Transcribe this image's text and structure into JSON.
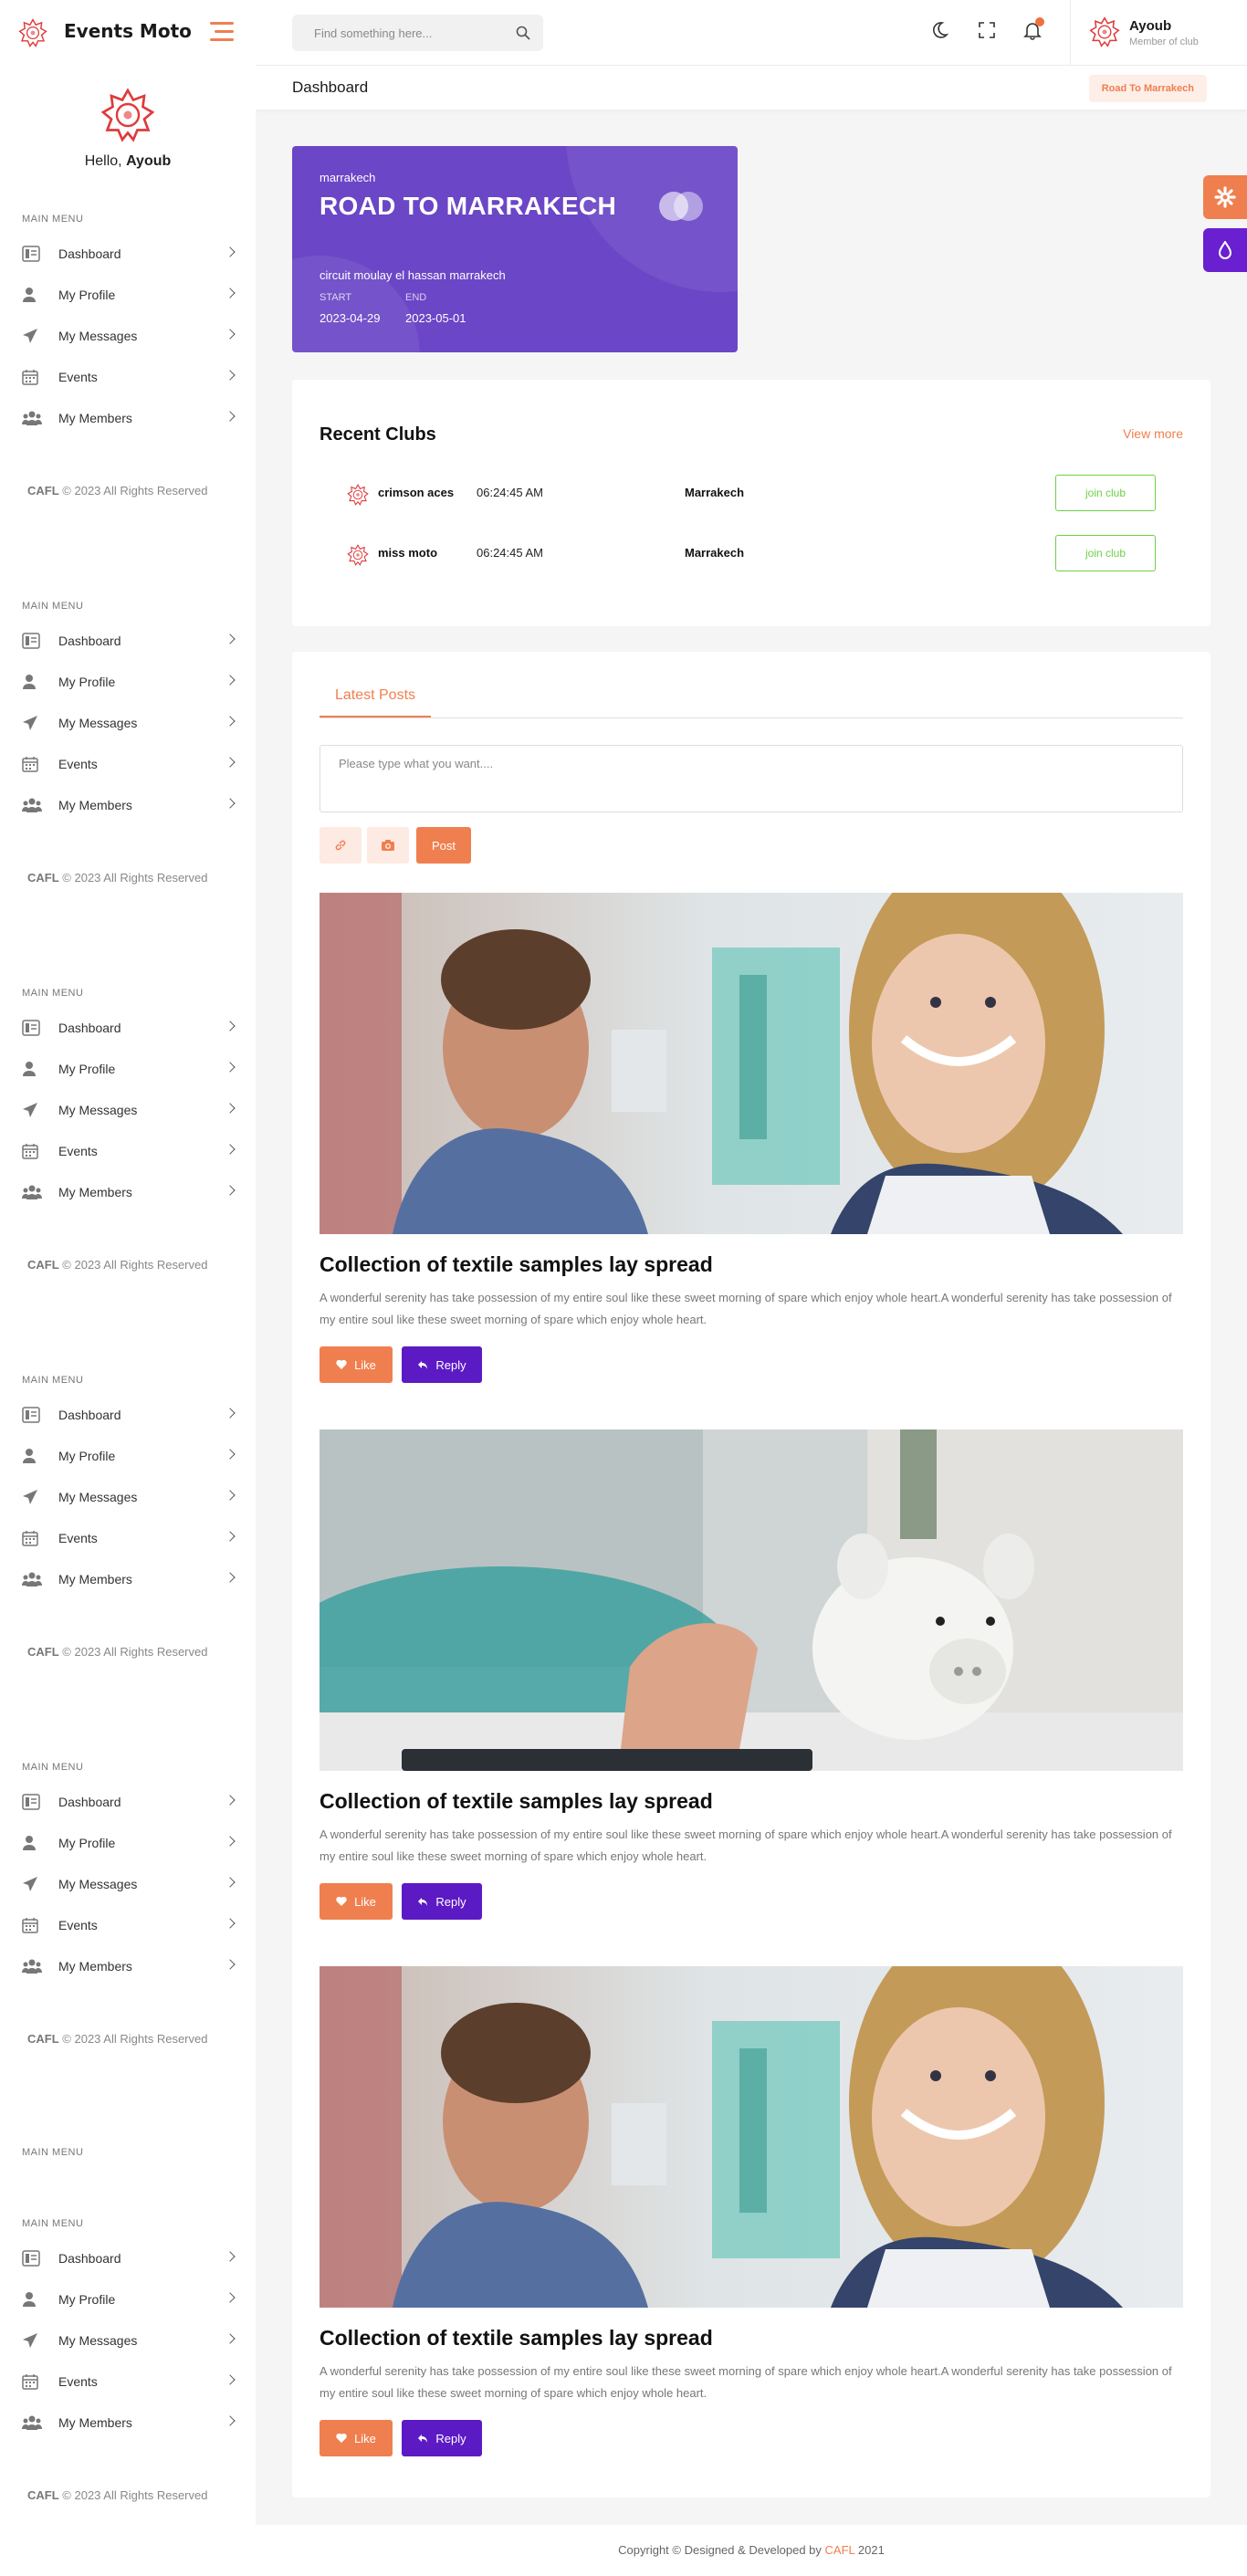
{
  "brand": {
    "name": "Events Moto",
    "logo_icon": "club-emblem-icon"
  },
  "search": {
    "placeholder": "Find something here..."
  },
  "user": {
    "name": "Ayoub",
    "role": "Member of club"
  },
  "page": {
    "title": "Dashboard",
    "breadcrumb": "Road To Marrakech"
  },
  "sidebar": {
    "hello_prefix": "Hello,",
    "hello_name": "Ayoub",
    "menu_title": "MAIN MENU",
    "items": [
      {
        "label": "Dashboard",
        "icon": "dashboard-icon"
      },
      {
        "label": "My Profile",
        "icon": "user-icon"
      },
      {
        "label": "My Messages",
        "icon": "paper-plane-icon"
      },
      {
        "label": "Events",
        "icon": "calendar-icon"
      },
      {
        "label": "My Members",
        "icon": "users-icon"
      }
    ],
    "copyright_brand": "CAFL",
    "copyright_text": "© 2023 All Rights Reserved"
  },
  "event": {
    "location": "marrakech",
    "title": "ROAD TO MARRAKECH",
    "address": "circuit moulay el hassan marrakech",
    "start_label": "START",
    "start": "2023-04-29",
    "end_label": "END",
    "end": "2023-05-01"
  },
  "clubs": {
    "title": "Recent Clubs",
    "view_more": "View more",
    "rows": [
      {
        "name": "crimson aces",
        "time": "06:24:45 AM",
        "city": "Marrakech",
        "action": "join club"
      },
      {
        "name": "miss moto",
        "time": "06:24:45 AM",
        "city": "Marrakech",
        "action": "join club"
      }
    ]
  },
  "posts": {
    "tab": "Latest Posts",
    "placeholder": "Please type what you want....",
    "post_label": "Post",
    "like_label": "Like",
    "reply_label": "Reply",
    "items": [
      {
        "title": "Collection of textile samples lay spread",
        "body": "A wonderful serenity has take possession of my entire soul like these sweet morning of spare which enjoy whole heart.A wonderful serenity has take possession of my entire soul like these sweet morning of spare which enjoy whole heart.",
        "image": "couple-photo"
      },
      {
        "title": "Collection of textile samples lay spread",
        "body": "A wonderful serenity has take possession of my entire soul like these sweet morning of spare which enjoy whole heart.A wonderful serenity has take possession of my entire soul like these sweet morning of spare which enjoy whole heart.",
        "image": "piggy-bank-photo"
      },
      {
        "title": "Collection of textile samples lay spread",
        "body": "A wonderful serenity has take possession of my entire soul like these sweet morning of spare which enjoy whole heart.A wonderful serenity has take possession of my entire soul like these sweet morning of spare which enjoy whole heart.",
        "image": "couple-photo"
      }
    ]
  },
  "footer": {
    "prefix": "Copyright © Designed & Developed by",
    "brand": "CAFL",
    "year": "2021"
  },
  "colors": {
    "accent": "#f07f4f",
    "purple": "#6b46c6",
    "reply": "#5c1ac4",
    "success": "#6fcf48"
  }
}
